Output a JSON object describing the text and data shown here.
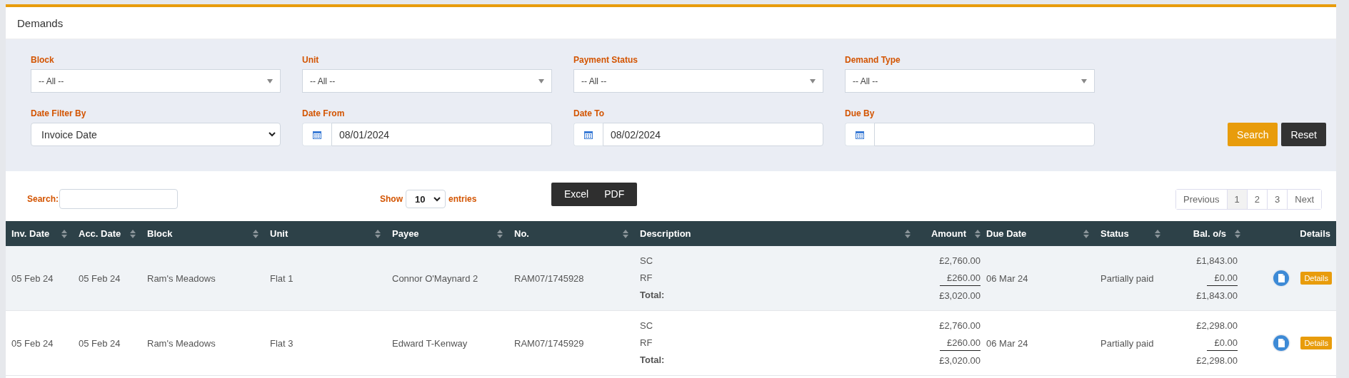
{
  "panel": {
    "title": "Demands"
  },
  "filters": [
    {
      "label": "Block",
      "kind": "select",
      "value": "-- All --"
    },
    {
      "label": "Unit",
      "kind": "select",
      "value": "-- All --"
    },
    {
      "label": "Payment Status",
      "kind": "select",
      "value": "-- All --"
    },
    {
      "label": "Demand Type",
      "kind": "select",
      "value": "-- All --"
    },
    {
      "label": "Date Filter By",
      "kind": "dropdown",
      "value": "Invoice Date"
    },
    {
      "label": "Date From",
      "kind": "date",
      "value": "08/01/2024"
    },
    {
      "label": "Date To",
      "kind": "date",
      "value": "08/02/2024"
    },
    {
      "label": "Due By",
      "kind": "date"
    }
  ],
  "filter_buttons": [
    {
      "label": "Search",
      "kind": "primary"
    },
    {
      "label": "Reset",
      "kind": "dark"
    }
  ],
  "table_search": {
    "label": "Search:"
  },
  "page_length": {
    "prefix": "Show",
    "value": "10",
    "suffix": "entries"
  },
  "export_buttons": [
    "Excel",
    "PDF"
  ],
  "pagination": [
    {
      "label": "Previous",
      "selected": false
    },
    {
      "label": "1",
      "selected": true
    },
    {
      "label": "2",
      "selected": false
    },
    {
      "label": "3",
      "selected": false
    },
    {
      "label": "Next",
      "selected": false
    }
  ],
  "table": {
    "columns": [
      {
        "label": "Inv. Date",
        "sortable": true
      },
      {
        "label": "Acc. Date",
        "sortable": true
      },
      {
        "label": "Block",
        "sortable": true
      },
      {
        "label": "Unit",
        "sortable": true
      },
      {
        "label": "Payee",
        "sortable": true
      },
      {
        "label": "No.",
        "sortable": true
      },
      {
        "label": "Description",
        "sortable": true
      },
      {
        "label": "Amount",
        "sortable": true
      },
      {
        "label": "Due Date",
        "sortable": true
      },
      {
        "label": "Status",
        "sortable": true
      },
      {
        "label": "Bal. o/s",
        "sortable": true
      },
      {
        "label": "Details",
        "sortable": false
      }
    ],
    "rows": [
      {
        "inv_date": "05 Feb 24",
        "acc_date": "05 Feb 24",
        "block": "Ram's Meadows",
        "unit": "Flat 1",
        "payee": "Connor O'Maynard 2",
        "number": "RAM07/1745928",
        "lines": [
          {
            "description": "SC",
            "amount": "£2,760.00",
            "balance": "£1,843.00"
          },
          {
            "description": "RF",
            "amount": "£260.00",
            "balance": "£0.00"
          }
        ],
        "total": {
          "label": "Total:",
          "amount": "£3,020.00",
          "balance": "£1,843.00"
        },
        "due_date": "06 Mar 24",
        "status": "Partially paid",
        "details": "Details"
      },
      {
        "inv_date": "05 Feb 24",
        "acc_date": "05 Feb 24",
        "block": "Ram's Meadows",
        "unit": "Flat 3",
        "payee": "Edward T-Kenway",
        "number": "RAM07/1745929",
        "lines": [
          {
            "description": "SC",
            "amount": "£2,760.00",
            "balance": "£2,298.00"
          },
          {
            "description": "RF",
            "amount": "£260.00",
            "balance": "£0.00"
          }
        ],
        "total": {
          "label": "Total:",
          "amount": "£3,020.00",
          "balance": "£2,298.00"
        },
        "due_date": "06 Mar 24",
        "status": "Partially paid",
        "details": "Details"
      }
    ]
  }
}
